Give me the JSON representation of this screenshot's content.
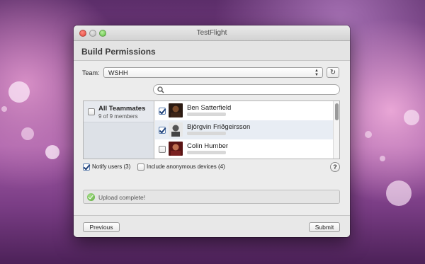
{
  "window": {
    "title": "TestFlight"
  },
  "header": {
    "heading": "Build Permissions"
  },
  "team": {
    "label": "Team:",
    "selected": "WSHH"
  },
  "search": {
    "placeholder": ""
  },
  "group": {
    "title": "All Teammates",
    "count": "9 of 9 members",
    "checked": false
  },
  "members": [
    {
      "name": "Ben Satterfield",
      "checked": true
    },
    {
      "name": "Björgvin Friðgeirsson",
      "checked": true
    },
    {
      "name": "Colin Humber",
      "checked": false
    }
  ],
  "options": {
    "notify_label": "Notify users (3)",
    "notify_checked": true,
    "anonymous_label": "Include anonymous devices (4)",
    "anonymous_checked": false
  },
  "status": {
    "message": "Upload complete!"
  },
  "footer": {
    "previous_label": "Previous",
    "submit_label": "Submit"
  },
  "icons": {
    "refresh": "refresh-icon",
    "search": "search-icon",
    "help": "help-icon",
    "success": "checkmark-circle-icon"
  }
}
